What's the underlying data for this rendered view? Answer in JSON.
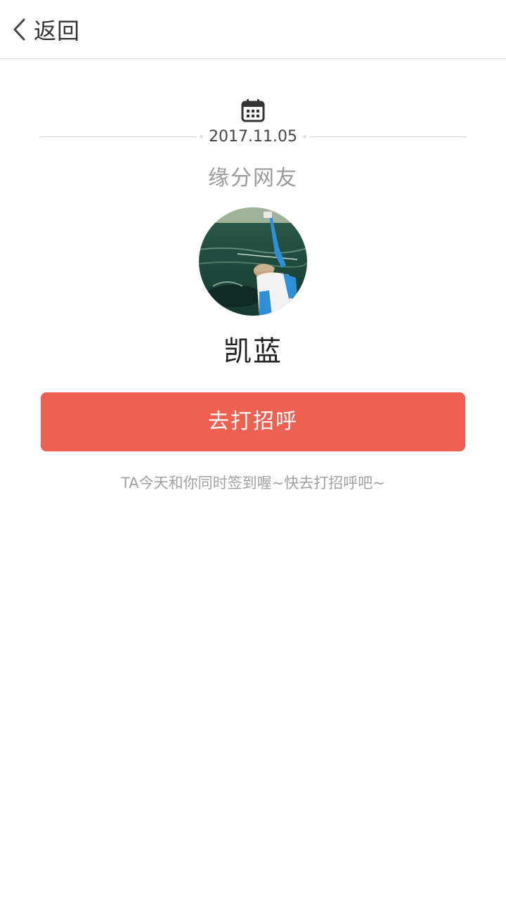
{
  "nav": {
    "back_label": "返回",
    "back_icon": "chevron-left-icon"
  },
  "content": {
    "calendar_icon": "calendar-icon",
    "date": "2017.11.05",
    "subtitle": "缘分网友",
    "avatar_icon": "avatar-photo",
    "username": "凯蓝",
    "greet_button_label": "去打招呼",
    "hint": "TA今天和你同时签到喔~快去打招呼吧~"
  },
  "colors": {
    "accent": "#ee6152",
    "text_primary": "#222222",
    "text_secondary": "#9a9a9a",
    "divider": "#dcdcdc"
  }
}
